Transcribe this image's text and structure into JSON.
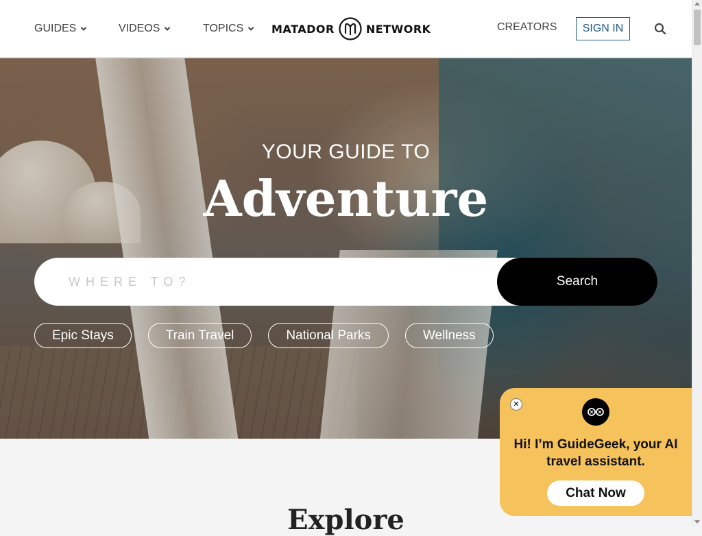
{
  "header": {
    "nav": [
      {
        "label": "GUIDES",
        "icon": "chevron-down-icon"
      },
      {
        "label": "VIDEOS",
        "icon": "chevron-down-icon"
      },
      {
        "label": "TOPICS",
        "icon": "chevron-down-icon"
      }
    ],
    "logo": {
      "left_word": "MATADOR",
      "right_word": "NETWORK"
    },
    "creators_label": "CREATORS",
    "signin_label": "SIGN IN",
    "search_icon": "search-icon"
  },
  "hero": {
    "subtitle": "YOUR GUIDE TO",
    "title": "Adventure",
    "search": {
      "placeholder": "WHERE TO?",
      "value": "",
      "button_label": "Search"
    },
    "chips": [
      "Epic Stays",
      "Train Travel",
      "National Parks",
      "Wellness"
    ]
  },
  "section": {
    "heading": "Explore"
  },
  "chat_popup": {
    "close_label": "✕",
    "message": "Hi! I’m GuideGeek, your AI travel assistant.",
    "button_label": "Chat Now"
  },
  "colors": {
    "signin_border": "#1f5a86",
    "chat_background": "#f6c25b",
    "search_button": "#000000"
  }
}
